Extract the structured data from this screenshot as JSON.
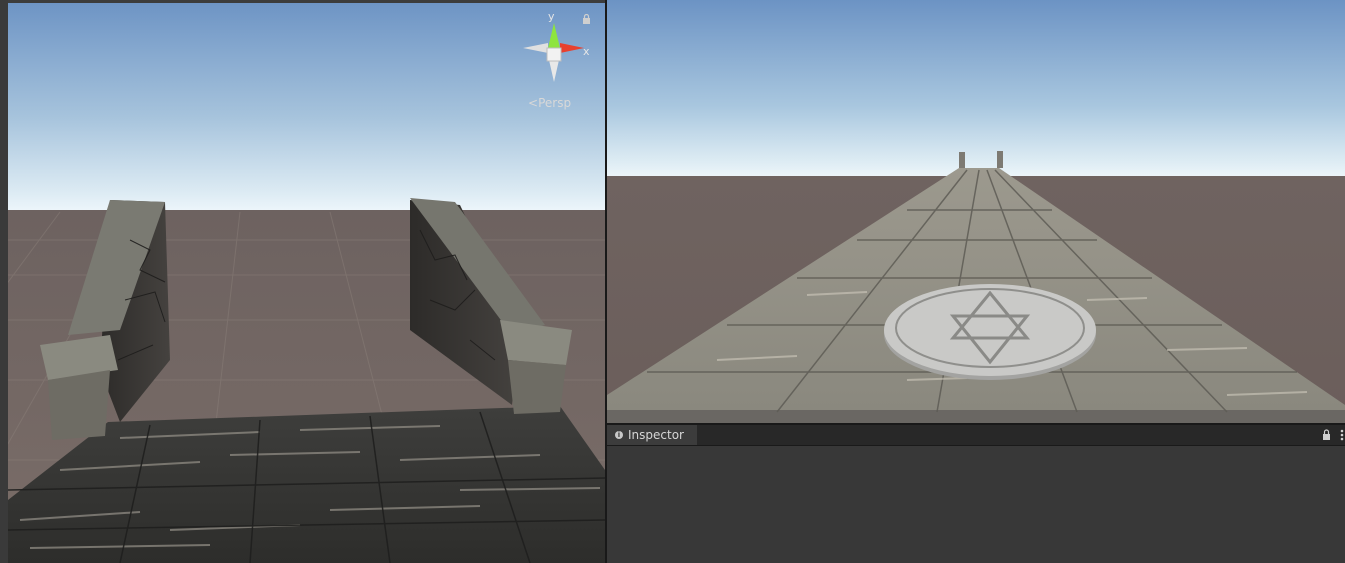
{
  "scene_view": {
    "gizmo": {
      "y_label": "y",
      "x_label": "x",
      "projection_label": "Persp"
    },
    "icons": {
      "lock": "lock-icon",
      "gizmo": "orientation-gizmo-icon"
    }
  },
  "game_view": {
    "icons": {
      "floor_emblem": "hexagram-emblem"
    }
  },
  "inspector": {
    "tab_label": "Inspector",
    "tab_icon": "info-icon",
    "lock_icon": "lock-icon",
    "menu_icon": "kebab-menu-icon"
  },
  "colors": {
    "sky_top": "#6c93c4",
    "horizon": "#dfeef7",
    "ground": "#7d6f69",
    "panel_bg": "#383838",
    "gizmo_y": "#8ee43f",
    "gizmo_x": "#e8402e"
  }
}
